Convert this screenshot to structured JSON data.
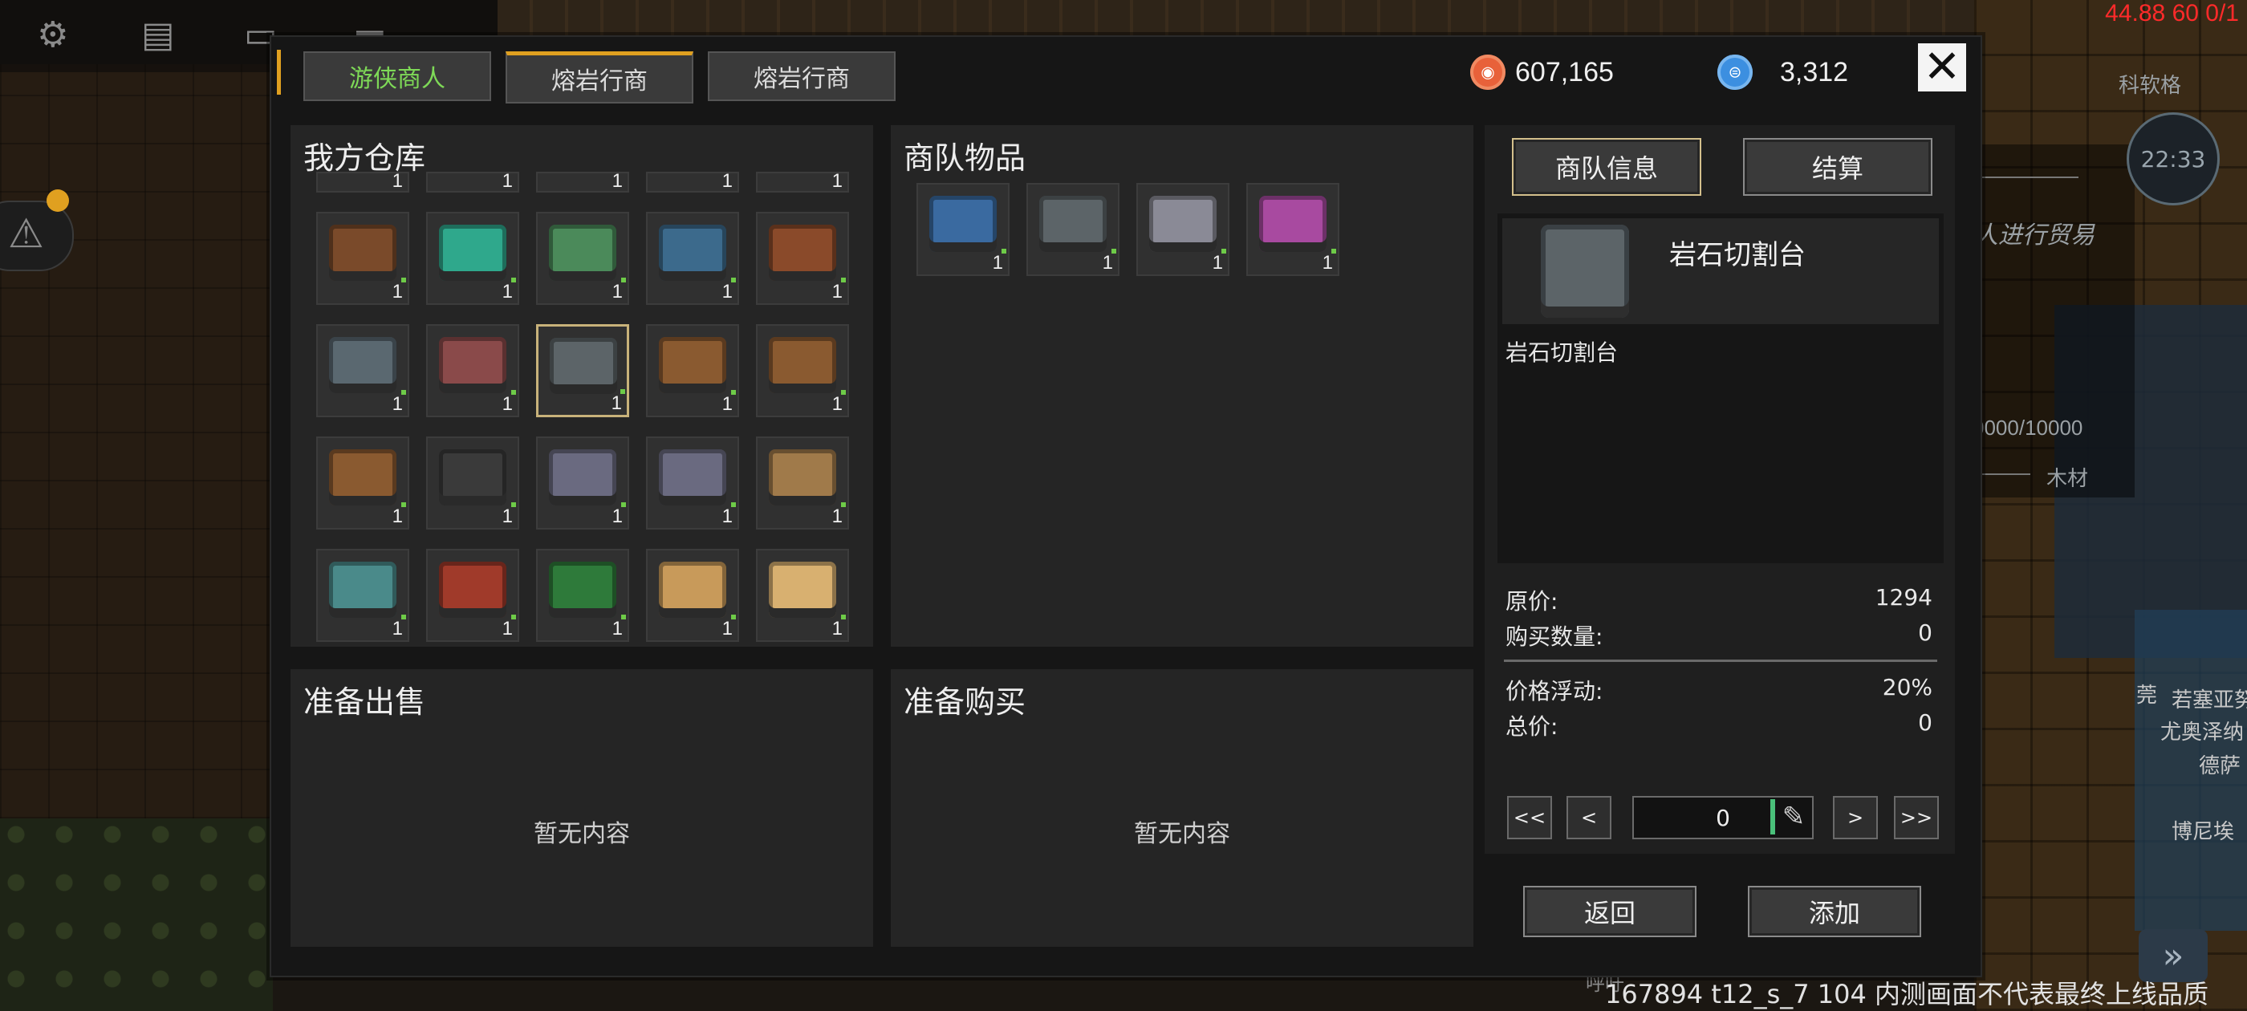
{
  "hud": {
    "top_right_stats": "44.88 60 0/1",
    "clock": "22:33",
    "watermark": "167894 t12_s_7 104 内测画面不代表最终上线品质",
    "bg_texts": [
      "科软格",
      "人进行贸易",
      "0000/10000",
      "木材",
      "若塞亚努",
      "尤奥泽纳",
      "德萨",
      "博尼埃",
      "莞",
      "呼吁"
    ],
    "top_icons": [
      "gear-icon",
      "chat-icon",
      "card-icon",
      "menu-icon"
    ]
  },
  "tabs": [
    {
      "label": "游侠商人",
      "state": "active"
    },
    {
      "label": "熔岩行商",
      "state": "selected"
    },
    {
      "label": "熔岩行商",
      "state": "normal"
    }
  ],
  "currency": {
    "gold": "607,165",
    "gems": "3,312"
  },
  "warehouse": {
    "title": "我方仓库",
    "partial_row_qty": [
      "1",
      "1",
      "1",
      "1",
      "1"
    ],
    "items": [
      {
        "icon": "plant-planter-icon",
        "qty": "1",
        "color": "#7a4a2a"
      },
      {
        "icon": "teal-capsule-icon",
        "qty": "1",
        "color": "#2fa88c"
      },
      {
        "icon": "green-machine-icon",
        "qty": "1",
        "color": "#4b8a5a"
      },
      {
        "icon": "blue-panel-icon",
        "qty": "1",
        "color": "#3c6a8c"
      },
      {
        "icon": "magnet-crate-icon",
        "qty": "1",
        "color": "#8a4a2a"
      },
      {
        "icon": "gray-workbench-icon",
        "qty": "1",
        "color": "#5a6870"
      },
      {
        "icon": "red-workbench-icon",
        "qty": "1",
        "color": "#8a4a4a"
      },
      {
        "icon": "stone-cutter-icon",
        "qty": "1",
        "color": "#5c6468"
      },
      {
        "icon": "anvil-bench-icon",
        "qty": "1",
        "color": "#8a5a30"
      },
      {
        "icon": "anvil-bench-icon",
        "qty": "1",
        "color": "#8a5a30"
      },
      {
        "icon": "anvil-bench-icon",
        "qty": "1",
        "color": "#8a5a30"
      },
      {
        "icon": "dark-cabinet-icon",
        "qty": "1",
        "color": "#3a3a3a"
      },
      {
        "icon": "console-desk-icon",
        "qty": "1",
        "color": "#6a6a80"
      },
      {
        "icon": "console-desk-icon",
        "qty": "1",
        "color": "#6a6a80"
      },
      {
        "icon": "wooden-desk-icon",
        "qty": "1",
        "color": "#a07a4a"
      },
      {
        "icon": "server-rack-icon",
        "qty": "1",
        "color": "#4a8a8a"
      },
      {
        "icon": "red-vending-icon",
        "qty": "1",
        "color": "#a03a2a"
      },
      {
        "icon": "pool-table-icon",
        "qty": "1",
        "color": "#2e7a3a"
      },
      {
        "icon": "chess-board-icon",
        "qty": "1",
        "color": "#c89a5a"
      },
      {
        "icon": "chess-board-icon",
        "qty": "1",
        "color": "#d8b070"
      }
    ]
  },
  "caravan": {
    "title": "商队物品",
    "items": [
      {
        "icon": "blue-door-icon",
        "qty": "1",
        "color": "#3a6aa0"
      },
      {
        "icon": "stone-cutter-icon",
        "qty": "1",
        "color": "#5c6468"
      },
      {
        "icon": "medical-robot-icon",
        "qty": "1",
        "color": "#8a8a96"
      },
      {
        "icon": "purple-beast-icon",
        "qty": "1",
        "color": "#a84aa0"
      }
    ]
  },
  "sell": {
    "title": "准备出售",
    "empty": "暂无内容"
  },
  "buy": {
    "title": "准备购买",
    "empty": "暂无内容"
  },
  "info": {
    "tab_caravan": "商队信息",
    "tab_settle": "结算",
    "item_name": "岩石切割台",
    "item_desc": "岩石切割台",
    "item_icon": "stone-cutter-icon",
    "original_price_label": "原价:",
    "original_price": "1294",
    "buy_qty_label": "购买数量:",
    "buy_qty": "0",
    "fluctuation_label": "价格浮动:",
    "fluctuation": "20%",
    "total_label": "总价:",
    "total": "0",
    "stepper": {
      "first": "<<",
      "prev": "<",
      "value": "0",
      "next": ">",
      "last": ">>"
    },
    "back_label": "返回",
    "add_label": "添加"
  }
}
